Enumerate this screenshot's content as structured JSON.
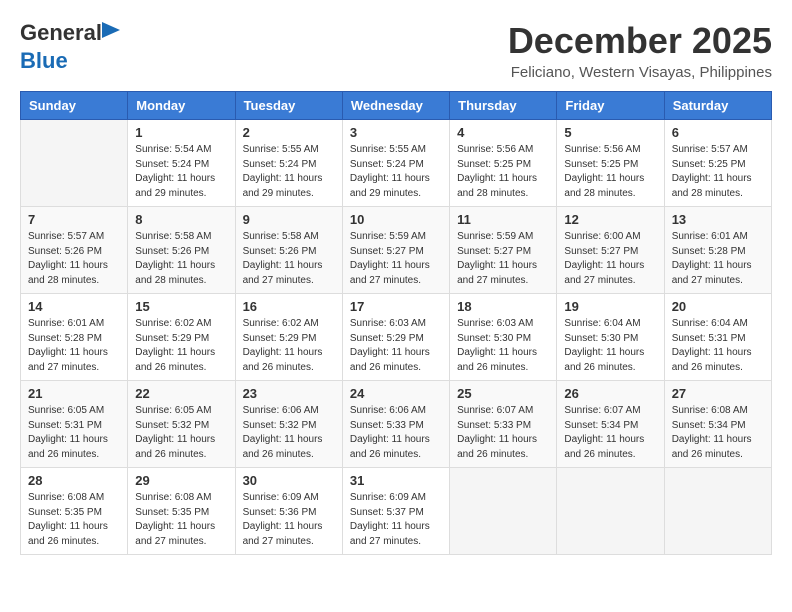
{
  "logo": {
    "text_general": "General",
    "text_blue": "Blue",
    "icon": "▶"
  },
  "title": "December 2025",
  "location": "Feliciano, Western Visayas, Philippines",
  "days_of_week": [
    "Sunday",
    "Monday",
    "Tuesday",
    "Wednesday",
    "Thursday",
    "Friday",
    "Saturday"
  ],
  "weeks": [
    [
      {
        "day": "",
        "info": ""
      },
      {
        "day": "1",
        "info": "Sunrise: 5:54 AM\nSunset: 5:24 PM\nDaylight: 11 hours\nand 29 minutes."
      },
      {
        "day": "2",
        "info": "Sunrise: 5:55 AM\nSunset: 5:24 PM\nDaylight: 11 hours\nand 29 minutes."
      },
      {
        "day": "3",
        "info": "Sunrise: 5:55 AM\nSunset: 5:24 PM\nDaylight: 11 hours\nand 29 minutes."
      },
      {
        "day": "4",
        "info": "Sunrise: 5:56 AM\nSunset: 5:25 PM\nDaylight: 11 hours\nand 28 minutes."
      },
      {
        "day": "5",
        "info": "Sunrise: 5:56 AM\nSunset: 5:25 PM\nDaylight: 11 hours\nand 28 minutes."
      },
      {
        "day": "6",
        "info": "Sunrise: 5:57 AM\nSunset: 5:25 PM\nDaylight: 11 hours\nand 28 minutes."
      }
    ],
    [
      {
        "day": "7",
        "info": "Sunrise: 5:57 AM\nSunset: 5:26 PM\nDaylight: 11 hours\nand 28 minutes."
      },
      {
        "day": "8",
        "info": "Sunrise: 5:58 AM\nSunset: 5:26 PM\nDaylight: 11 hours\nand 28 minutes."
      },
      {
        "day": "9",
        "info": "Sunrise: 5:58 AM\nSunset: 5:26 PM\nDaylight: 11 hours\nand 27 minutes."
      },
      {
        "day": "10",
        "info": "Sunrise: 5:59 AM\nSunset: 5:27 PM\nDaylight: 11 hours\nand 27 minutes."
      },
      {
        "day": "11",
        "info": "Sunrise: 5:59 AM\nSunset: 5:27 PM\nDaylight: 11 hours\nand 27 minutes."
      },
      {
        "day": "12",
        "info": "Sunrise: 6:00 AM\nSunset: 5:27 PM\nDaylight: 11 hours\nand 27 minutes."
      },
      {
        "day": "13",
        "info": "Sunrise: 6:01 AM\nSunset: 5:28 PM\nDaylight: 11 hours\nand 27 minutes."
      }
    ],
    [
      {
        "day": "14",
        "info": "Sunrise: 6:01 AM\nSunset: 5:28 PM\nDaylight: 11 hours\nand 27 minutes."
      },
      {
        "day": "15",
        "info": "Sunrise: 6:02 AM\nSunset: 5:29 PM\nDaylight: 11 hours\nand 26 minutes."
      },
      {
        "day": "16",
        "info": "Sunrise: 6:02 AM\nSunset: 5:29 PM\nDaylight: 11 hours\nand 26 minutes."
      },
      {
        "day": "17",
        "info": "Sunrise: 6:03 AM\nSunset: 5:29 PM\nDaylight: 11 hours\nand 26 minutes."
      },
      {
        "day": "18",
        "info": "Sunrise: 6:03 AM\nSunset: 5:30 PM\nDaylight: 11 hours\nand 26 minutes."
      },
      {
        "day": "19",
        "info": "Sunrise: 6:04 AM\nSunset: 5:30 PM\nDaylight: 11 hours\nand 26 minutes."
      },
      {
        "day": "20",
        "info": "Sunrise: 6:04 AM\nSunset: 5:31 PM\nDaylight: 11 hours\nand 26 minutes."
      }
    ],
    [
      {
        "day": "21",
        "info": "Sunrise: 6:05 AM\nSunset: 5:31 PM\nDaylight: 11 hours\nand 26 minutes."
      },
      {
        "day": "22",
        "info": "Sunrise: 6:05 AM\nSunset: 5:32 PM\nDaylight: 11 hours\nand 26 minutes."
      },
      {
        "day": "23",
        "info": "Sunrise: 6:06 AM\nSunset: 5:32 PM\nDaylight: 11 hours\nand 26 minutes."
      },
      {
        "day": "24",
        "info": "Sunrise: 6:06 AM\nSunset: 5:33 PM\nDaylight: 11 hours\nand 26 minutes."
      },
      {
        "day": "25",
        "info": "Sunrise: 6:07 AM\nSunset: 5:33 PM\nDaylight: 11 hours\nand 26 minutes."
      },
      {
        "day": "26",
        "info": "Sunrise: 6:07 AM\nSunset: 5:34 PM\nDaylight: 11 hours\nand 26 minutes."
      },
      {
        "day": "27",
        "info": "Sunrise: 6:08 AM\nSunset: 5:34 PM\nDaylight: 11 hours\nand 26 minutes."
      }
    ],
    [
      {
        "day": "28",
        "info": "Sunrise: 6:08 AM\nSunset: 5:35 PM\nDaylight: 11 hours\nand 26 minutes."
      },
      {
        "day": "29",
        "info": "Sunrise: 6:08 AM\nSunset: 5:35 PM\nDaylight: 11 hours\nand 27 minutes."
      },
      {
        "day": "30",
        "info": "Sunrise: 6:09 AM\nSunset: 5:36 PM\nDaylight: 11 hours\nand 27 minutes."
      },
      {
        "day": "31",
        "info": "Sunrise: 6:09 AM\nSunset: 5:37 PM\nDaylight: 11 hours\nand 27 minutes."
      },
      {
        "day": "",
        "info": ""
      },
      {
        "day": "",
        "info": ""
      },
      {
        "day": "",
        "info": ""
      }
    ]
  ]
}
